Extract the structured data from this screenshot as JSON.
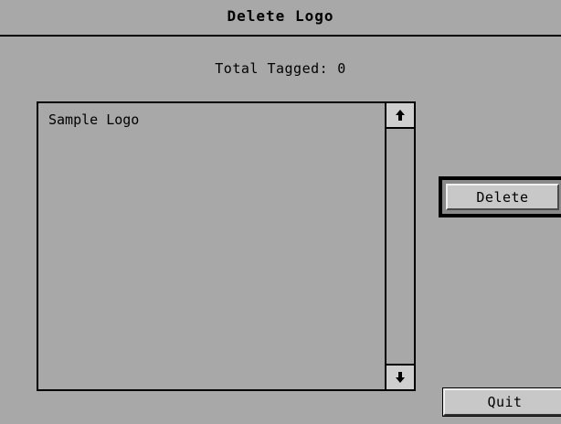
{
  "window": {
    "title": "Delete Logo"
  },
  "status": {
    "total_label": "Total Tagged:",
    "total_count": "0"
  },
  "list": {
    "items": [
      "Sample Logo"
    ]
  },
  "scrollbar": {
    "up_icon": "arrow-up-icon",
    "down_icon": "arrow-down-icon"
  },
  "buttons": {
    "delete_label": "Delete",
    "quit_label": "Quit"
  },
  "colors": {
    "background": "#a8a8a8",
    "button_face": "#c8c8c8"
  }
}
